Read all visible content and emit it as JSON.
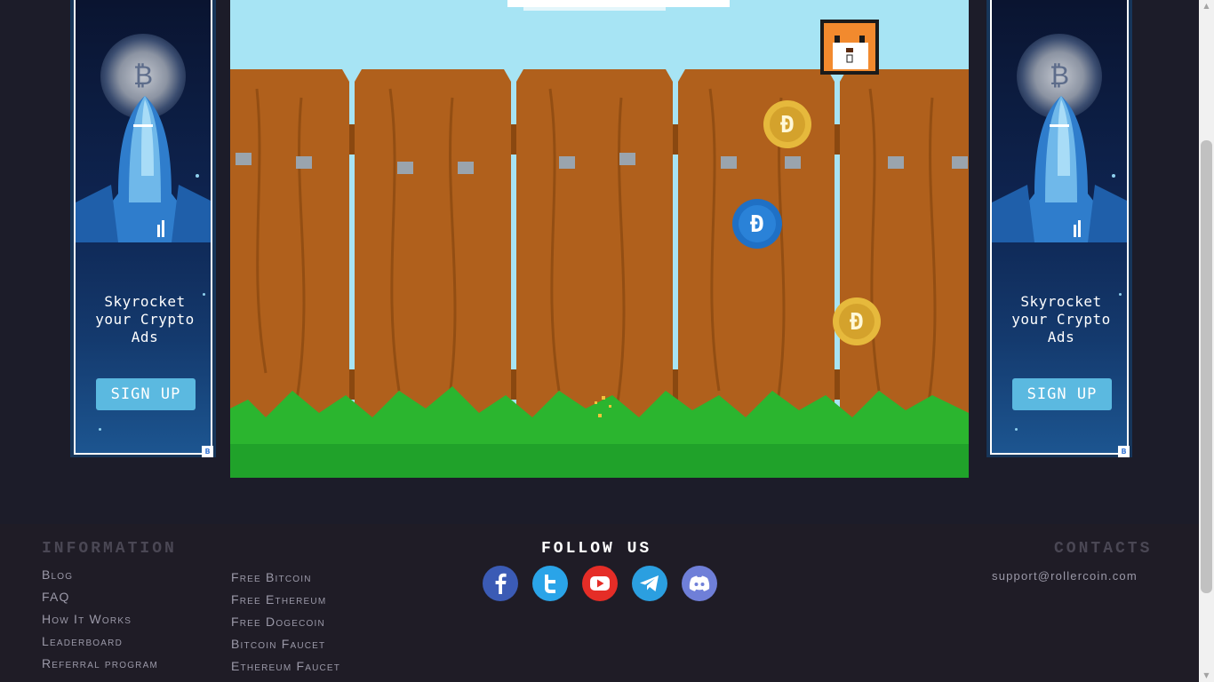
{
  "ads": {
    "left": {
      "headline": [
        "Skyrocket",
        "your Crypto",
        "Ads"
      ],
      "button_label": "SIGN UP",
      "badge": "B",
      "coin_symbol": "₿"
    },
    "right": {
      "headline": [
        "Skyrocket",
        "your Crypto",
        "Ads"
      ],
      "button_label": "SIGN UP",
      "badge": "B",
      "coin_symbol": "₿"
    }
  },
  "game": {
    "character": "hamster-icon",
    "coins": [
      {
        "type": "gold",
        "symbol": "Ð"
      },
      {
        "type": "blue",
        "symbol": "Ð"
      },
      {
        "type": "gold",
        "symbol": "Ð"
      }
    ],
    "colors": {
      "sky": "#a7e4f4",
      "fence": "#b0601c",
      "grass": "#2bb52f"
    }
  },
  "footer": {
    "information_heading": "Information",
    "information_links": [
      "Blog",
      "FAQ",
      "How It Works",
      "Leaderboard",
      "Referral program"
    ],
    "more_links": [
      "Free Bitcoin",
      "Free Ethereum",
      "Free Dogecoin",
      "Bitcoin Faucet",
      "Ethereum Faucet"
    ],
    "follow_heading": "Follow us",
    "social": [
      "facebook-icon",
      "twitter-icon",
      "youtube-icon",
      "telegram-icon",
      "discord-icon"
    ],
    "contacts_heading": "Contacts",
    "email": "support@rollercoin.com"
  }
}
